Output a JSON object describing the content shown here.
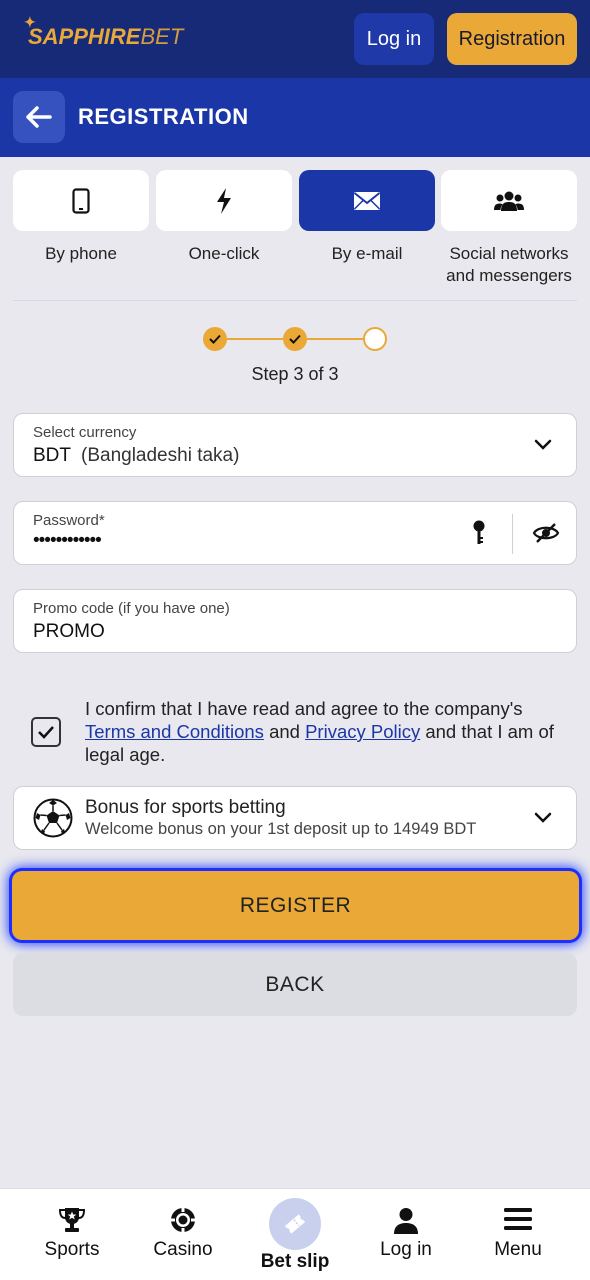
{
  "header": {
    "logo_part1": "SAPPHIRE",
    "logo_part2": "BET",
    "login_label": "Log in",
    "registration_label": "Registration"
  },
  "titlebar": {
    "title": "REGISTRATION"
  },
  "methods": [
    {
      "label": "By phone",
      "icon": "phone-icon",
      "active": false
    },
    {
      "label": "One-click",
      "icon": "lightning-icon",
      "active": false
    },
    {
      "label": "By e-mail",
      "icon": "envelope-icon",
      "active": true
    },
    {
      "label": "Social networks and messengers",
      "icon": "people-icon",
      "active": false
    }
  ],
  "steps": {
    "text": "Step 3 of 3",
    "completed": 2,
    "total": 3
  },
  "currency": {
    "label": "Select currency",
    "code": "BDT",
    "name": "(Bangladeshi taka)"
  },
  "password": {
    "label": "Password*",
    "value": "••••••••••••"
  },
  "promo": {
    "label": "Promo code (if you have one)",
    "value": "PROMO"
  },
  "consent": {
    "checked": true,
    "text_before": "I confirm that I have read and agree to the company's",
    "terms_link": "Terms and Conditions",
    "and": "and",
    "privacy_link": "Privacy Policy",
    "text_after": "and that I am of legal age."
  },
  "bonus": {
    "title": "Bonus for sports betting",
    "subtitle": "Welcome bonus on your 1st deposit up to 14949 BDT"
  },
  "buttons": {
    "register": "REGISTER",
    "back": "BACK"
  },
  "bottom_nav": [
    {
      "label": "Sports",
      "icon": "trophy-icon"
    },
    {
      "label": "Casino",
      "icon": "casino-chip-icon"
    },
    {
      "label": "Bet slip",
      "icon": "ticket-icon"
    },
    {
      "label": "Log in",
      "icon": "user-icon"
    },
    {
      "label": "Menu",
      "icon": "hamburger-icon"
    }
  ],
  "colors": {
    "primary": "#1b36a6",
    "header": "#162a78",
    "accent": "#eaa836"
  }
}
